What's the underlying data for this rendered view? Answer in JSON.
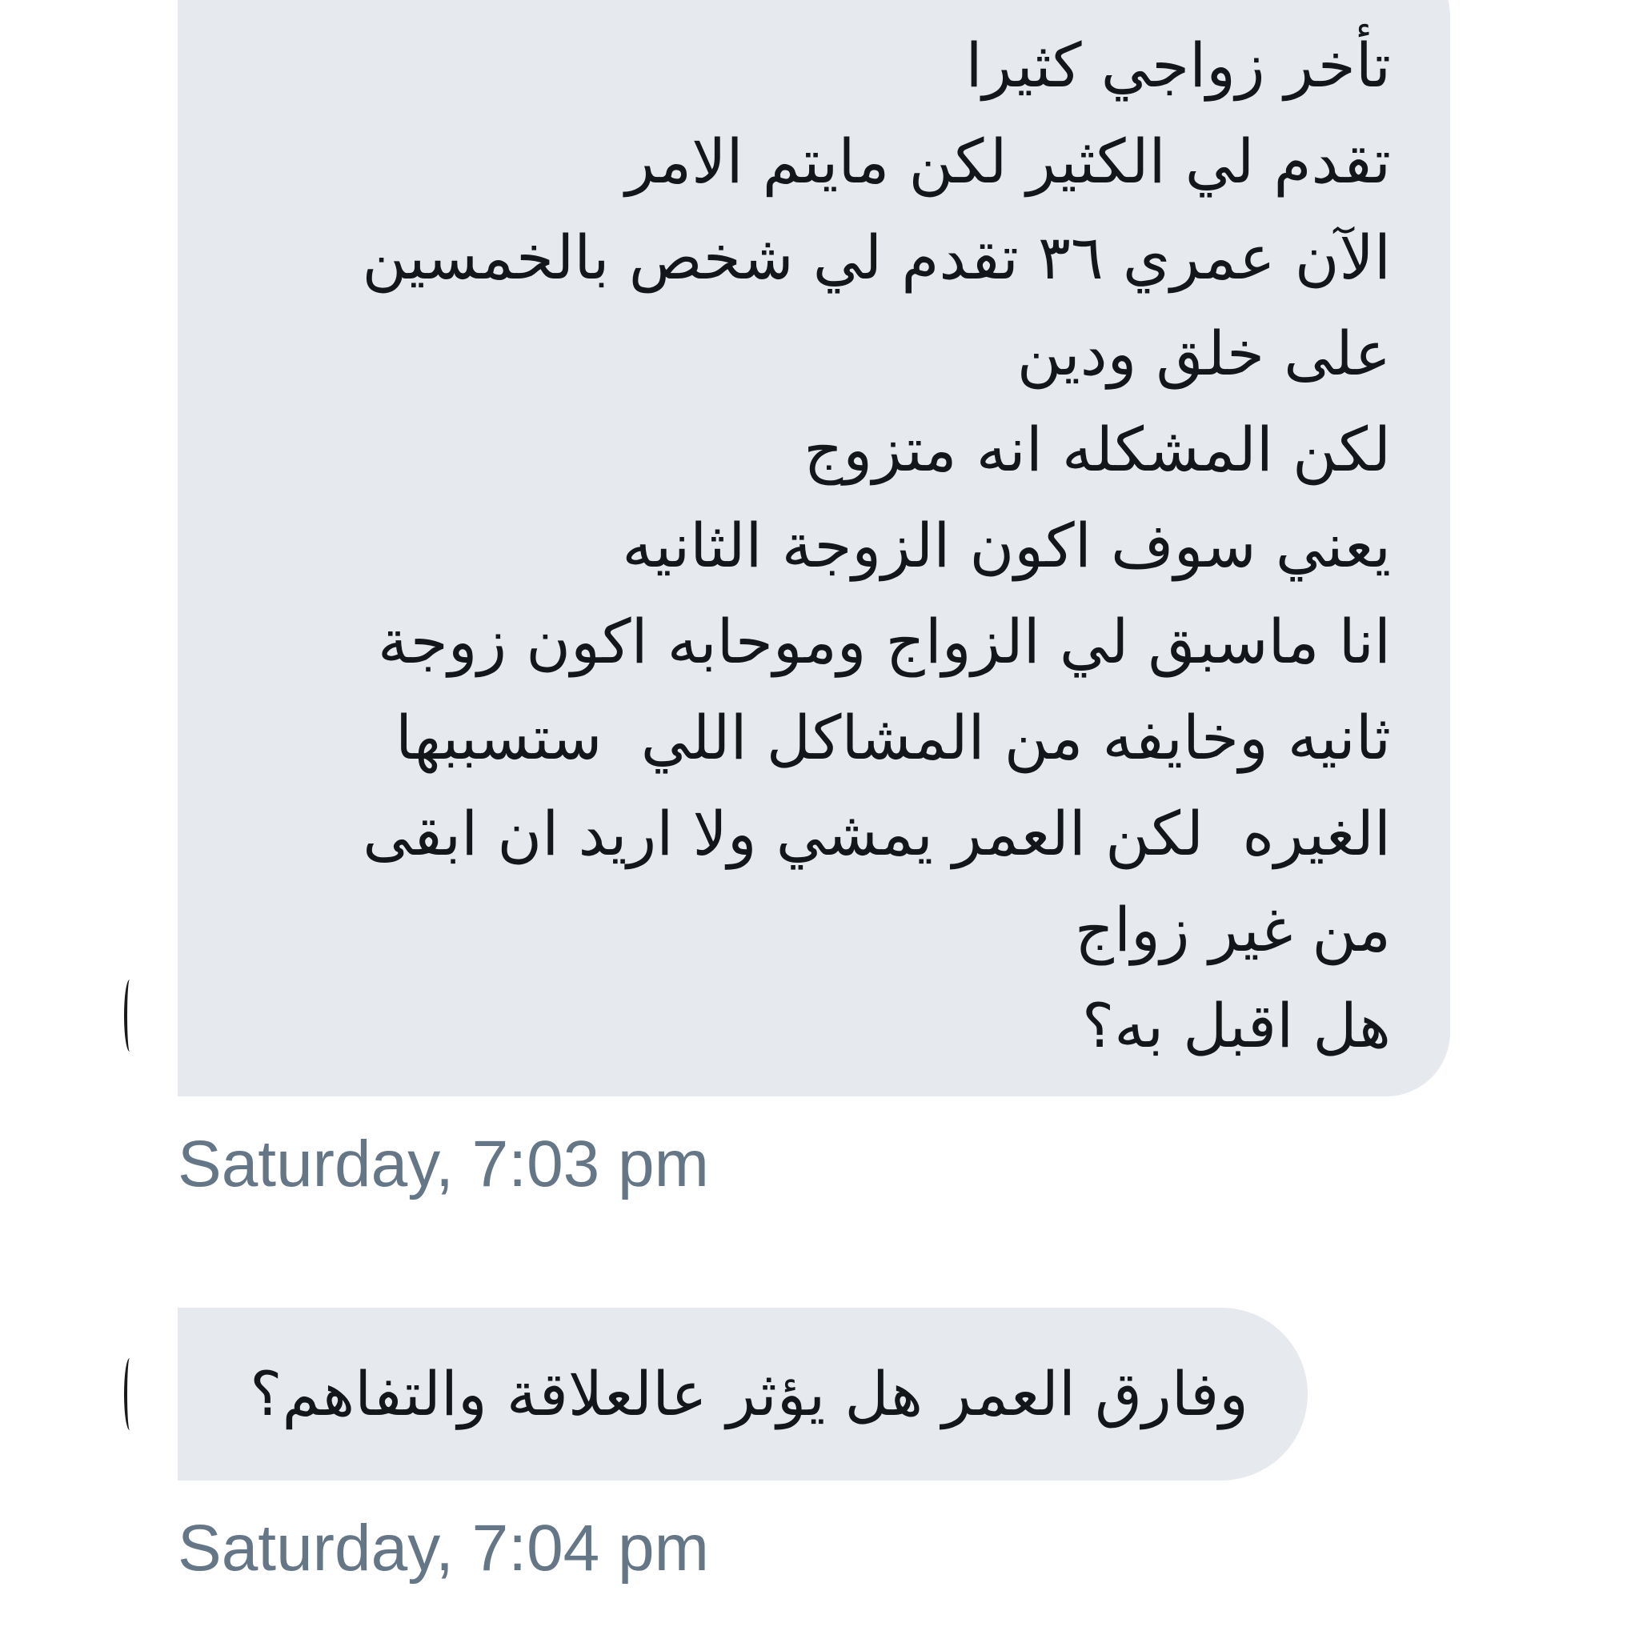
{
  "messages": [
    {
      "lines": [
        "تأخر زواجي كثيرا",
        "تقدم لي الكثير لكن مايتم الامر",
        "الآن عمري ٣٦ تقدم لي شخص بالخمسين",
        "على خلق ودين",
        "لكن المشكله انه متزوج",
        "يعني سوف اكون الزوجة الثانيه",
        "انا ماسبق لي الزواج وموحابه اكون زوجة",
        "ثانيه وخايفه من المشاكل اللي  ستسببها",
        "الغيره  لكن العمر يمشي ولا اريد ان ابقى",
        "من غير زواج",
        "هل اقبل به؟"
      ],
      "timestamp": "Saturday, 7:03 pm"
    },
    {
      "text": "وفارق العمر هل يؤثر عالعلاقة والتفاهم؟",
      "timestamp": "Saturday, 7:04 pm"
    }
  ]
}
